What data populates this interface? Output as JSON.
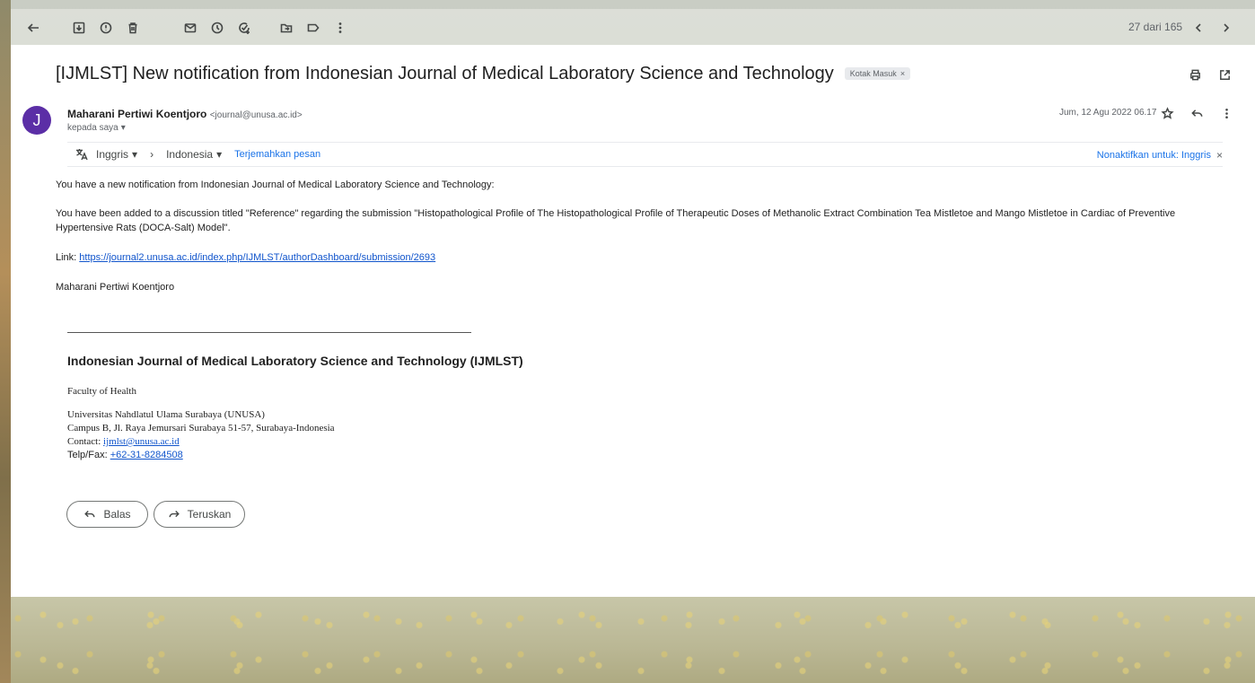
{
  "toolbar": {
    "counter": "27 dari 165",
    "icons": [
      "back-arrow-icon",
      "archive-icon",
      "report-spam-icon",
      "delete-icon",
      "mark-unread-icon",
      "snooze-icon",
      "add-task-icon",
      "move-to-icon",
      "label-icon",
      "more-vert-icon",
      "older-chevron-icon",
      "newer-chevron-icon"
    ]
  },
  "email": {
    "subject": "[IJMLST] New notification from Indonesian Journal of Medical Laboratory Science and Technology",
    "label_chip": "Kotak Masuk",
    "avatar_letter": "J",
    "avatar_color": "#5b2ea6",
    "sender_name": "Maharani Pertiwi Koentjoro",
    "sender_email": "<journal@unusa.ac.id>",
    "to": "kepada saya",
    "date": "Jum, 12 Agu 2022 06.17"
  },
  "translate": {
    "from": "Inggris",
    "to": "Indonesia",
    "translate_link": "Terjemahkan pesan",
    "disable": "Nonaktifkan untuk: Inggris"
  },
  "body": {
    "line1": "You have a new notification from Indonesian Journal of Medical Laboratory Science and Technology:",
    "line2a": "You have been added to a discussion titled \"Reference\" regarding the submission \"Histopathological Profile of The Histopathological Profile of Therapeutic Doses of Methanolic Extract Combination Tea Mistletoe and Mango Mistletoe in Cardiac of Preventive",
    "line2b": "Hypertensive Rats (DOCA-Salt) Model\".",
    "link_label": "Link: ",
    "link_url": "https://journal2.unusa.ac.id/index.php/IJMLST/authorDashboard/submission/2693",
    "signoff": "Maharani Pertiwi Koentjoro"
  },
  "signature": {
    "title": "Indonesian Journal of Medical Laboratory Science and Technology (IJMLST)",
    "faculty": "Faculty of Health",
    "university": "Universitas Nahdlatul Ulama Surabaya (UNUSA)",
    "address": "Campus B, Jl. Raya Jemursari Surabaya 51-57, Surabaya-Indonesia",
    "contact_label": "Contact: ",
    "contact_email": "ijmlst@unusa.ac.id",
    "telp_label": "Telp/Fax: ",
    "telp": "+62-31-8284508"
  },
  "actions": {
    "reply": "Balas",
    "forward": "Teruskan"
  },
  "colors": {
    "link": "#1155cc",
    "accent": "#1a73e8"
  }
}
